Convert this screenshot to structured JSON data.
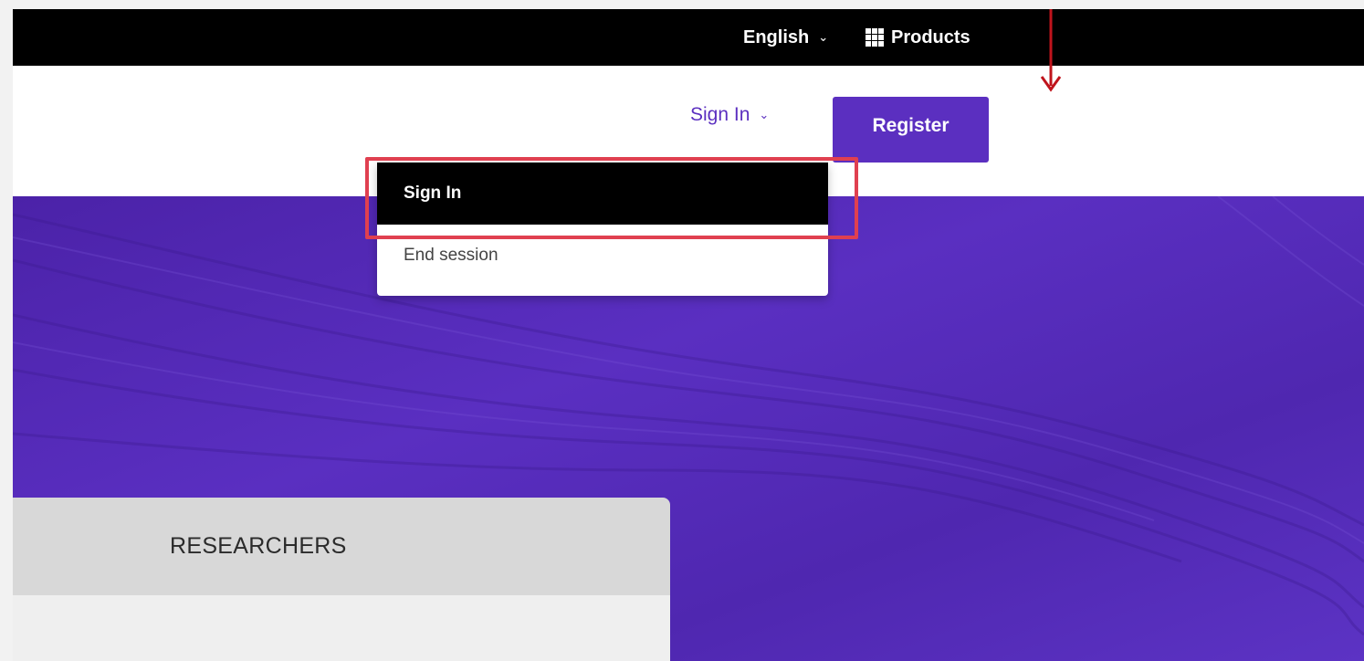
{
  "topbar": {
    "language": "English",
    "products": "Products"
  },
  "header": {
    "signin_label": "Sign In",
    "register_label": "Register"
  },
  "signin_menu": {
    "items": [
      {
        "label": "Sign In",
        "active": true
      },
      {
        "label": "End session",
        "active": false
      }
    ]
  },
  "card": {
    "title": "RESEARCHERS"
  },
  "colors": {
    "brand": "#5b2fc0",
    "topbar": "#000000",
    "highlight": "#e04050",
    "arrow": "#c0141c"
  },
  "icons": [
    "chevron-down-icon",
    "grid-icon",
    "arrow-down-icon"
  ]
}
